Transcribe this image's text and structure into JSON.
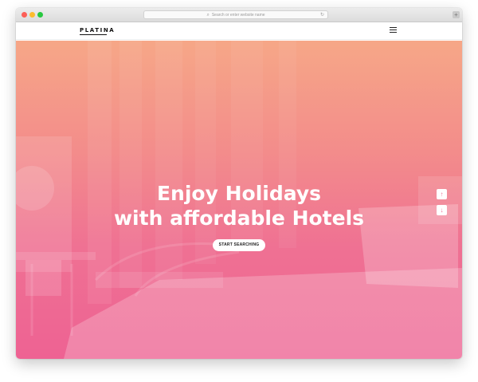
{
  "browser": {
    "url_placeholder": "Search or enter website name",
    "search_icon": "⌕",
    "reload_icon": "↻",
    "new_tab_icon": "+"
  },
  "site": {
    "logo": "PLATINA",
    "menu_icon": "hamburger-icon"
  },
  "hero": {
    "title_line1": "Enjoy Holidays",
    "title_line2": "with affordable Hotels",
    "cta_label": "START SEARCHING",
    "gradient_top": "#f6a787",
    "gradient_bottom": "#ee6293"
  },
  "scroll": {
    "up_icon": "↑",
    "down_icon": "↓"
  }
}
